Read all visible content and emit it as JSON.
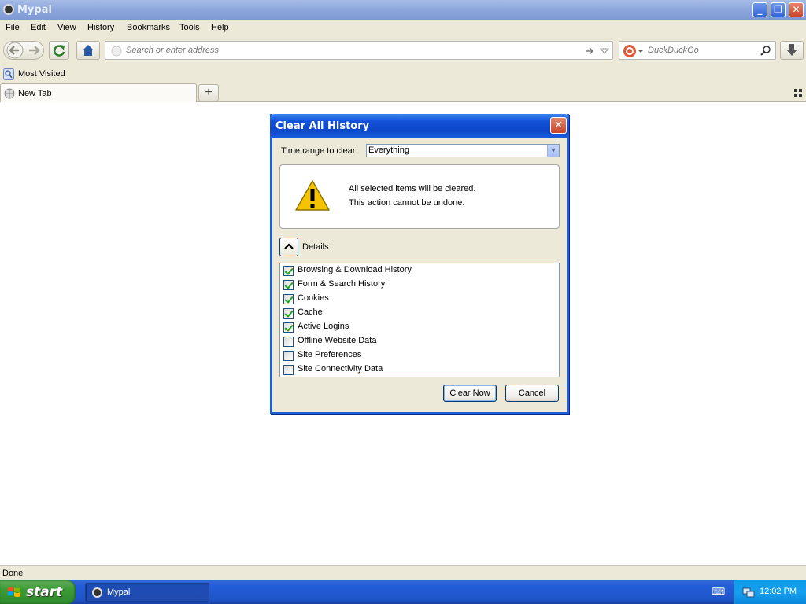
{
  "window": {
    "title": "Mypal"
  },
  "menu": [
    "File",
    "Edit",
    "View",
    "History",
    "Bookmarks",
    "Tools",
    "Help"
  ],
  "address_bar": {
    "placeholder": "Search or enter address"
  },
  "search_bar": {
    "placeholder": "DuckDuckGo"
  },
  "bookmarks": {
    "most_visited": "Most Visited"
  },
  "tabs": [
    {
      "label": "New Tab"
    }
  ],
  "dialog": {
    "title": "Clear All History",
    "time_range_label": "Time range to clear:",
    "time_range_value": "Everything",
    "warning_line1": "All selected items will be cleared.",
    "warning_line2": "This action cannot be undone.",
    "details_label": "Details",
    "items": [
      {
        "label": "Browsing & Download History",
        "checked": true
      },
      {
        "label": "Form & Search History",
        "checked": true
      },
      {
        "label": "Cookies",
        "checked": true
      },
      {
        "label": "Cache",
        "checked": true
      },
      {
        "label": "Active Logins",
        "checked": true
      },
      {
        "label": "Offline Website Data",
        "checked": false
      },
      {
        "label": "Site Preferences",
        "checked": false
      },
      {
        "label": "Site Connectivity Data",
        "checked": false
      }
    ],
    "clear_button": "Clear Now",
    "cancel_button": "Cancel"
  },
  "status": {
    "text": "Done"
  },
  "taskbar": {
    "start_label": "start",
    "task_item": "Mypal",
    "clock": "12:02 PM"
  },
  "colors": {
    "dialog_title": "#0d47c9",
    "warning_yellow": "#f5c400",
    "check_green": "#21a121"
  }
}
